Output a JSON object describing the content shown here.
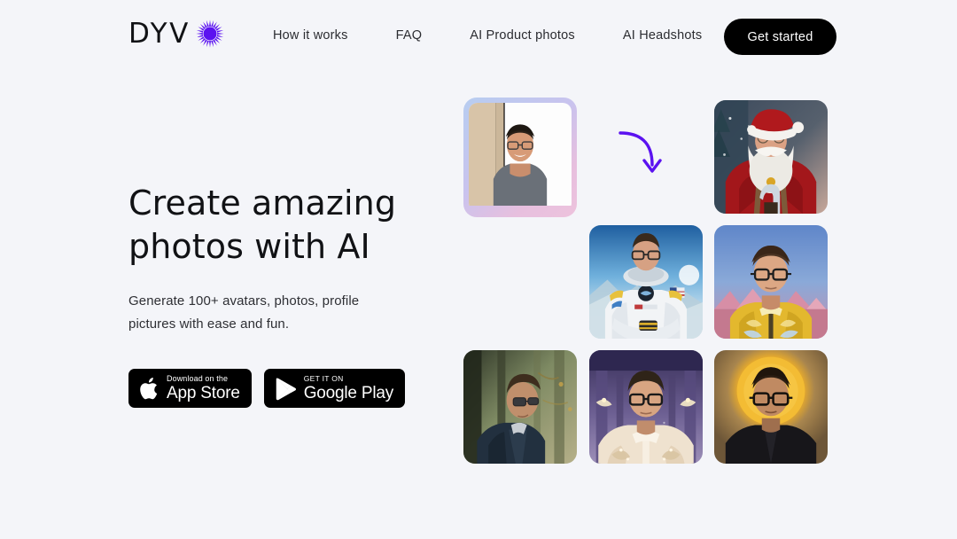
{
  "brand": {
    "name": "DYV",
    "star_icon": "purple-starburst-icon",
    "accent": "#5B12F0"
  },
  "header": {
    "nav": [
      {
        "label": "How it works",
        "name": "nav-how-it-works"
      },
      {
        "label": "FAQ",
        "name": "nav-faq"
      },
      {
        "label": "AI Product photos",
        "name": "nav-ai-product-photos"
      },
      {
        "label": "AI Headshots",
        "name": "nav-ai-headshots"
      }
    ],
    "cta_label": "Get started"
  },
  "hero": {
    "title": "Create amazing\nphotos with AI",
    "subtitle": "Generate 100+ avatars, photos, profile\npictures with ease and fun.",
    "badges": [
      {
        "name": "app-store-badge",
        "icon": "apple-icon",
        "small": "Download on the",
        "big": "App Store"
      },
      {
        "name": "google-play-badge",
        "icon": "google-play-icon",
        "small": "GET IT ON",
        "big": "Google Play"
      }
    ]
  },
  "gallery": {
    "arrow_icon": "curved-down-arrow-icon",
    "arrow_color": "#5B12F0",
    "source": {
      "name": "source-photo-card",
      "alt": "Smiling man with glasses in gray t-shirt, beige wall background",
      "border_gradient": [
        "#b7cdf0",
        "#edc3dd"
      ]
    },
    "results": [
      {
        "name": "result-photo-santa",
        "alt": "Santa Claus portrait in red suit with white beard, snowy forest background"
      },
      {
        "name": "result-photo-astronaut",
        "alt": "Man as astronaut in white spacesuit, blue sky and clouds background"
      },
      {
        "name": "result-photo-royal",
        "alt": "Man in gold embroidered jacket, pink mountains and blue sky background"
      },
      {
        "name": "result-photo-forest",
        "alt": "Man in navy jacket standing in a misty forest"
      },
      {
        "name": "result-photo-palace",
        "alt": "Man in ornate cream embroidered jacket in a purple palace hall"
      },
      {
        "name": "result-photo-golden",
        "alt": "Man in black shirt with a golden halo backdrop"
      }
    ]
  }
}
